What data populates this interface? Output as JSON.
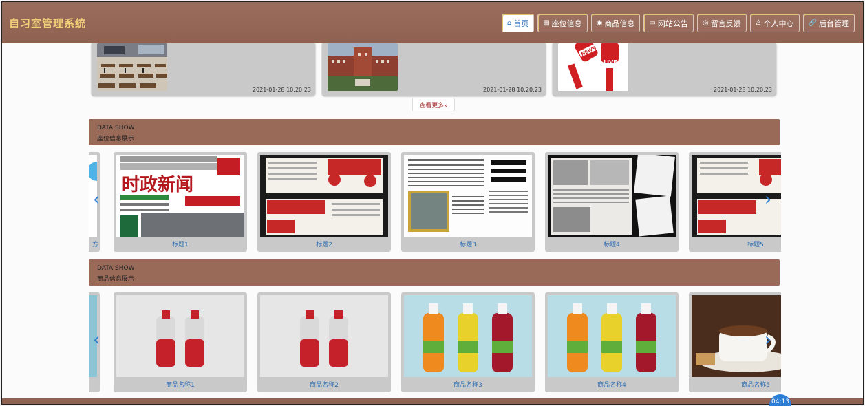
{
  "header": {
    "title": "自习室管理系统",
    "nav": [
      {
        "icon": "home-icon",
        "glyph": "⌂",
        "label": "首页"
      },
      {
        "icon": "seat-icon",
        "glyph": "▤",
        "label": "座位信息"
      },
      {
        "icon": "goods-icon",
        "glyph": "◉",
        "label": "商品信息"
      },
      {
        "icon": "notice-icon",
        "glyph": "▭",
        "label": "网站公告"
      },
      {
        "icon": "message-icon",
        "glyph": "◎",
        "label": "留言反馈"
      },
      {
        "icon": "user-icon",
        "glyph": "♙",
        "label": "个人中心"
      },
      {
        "icon": "link-icon",
        "glyph": "🔗",
        "label": "后台管理"
      }
    ]
  },
  "news": [
    {
      "time": "2021-01-28 10:20:23",
      "image": "classroom"
    },
    {
      "time": "2021-01-28 10:20:23",
      "image": "campus-building"
    },
    {
      "time": "2021-01-28 10:20:23",
      "image": "news-microphone",
      "badge1": "NEWS",
      "badge2": "LIVE"
    }
  ],
  "more_label": "查看更多»",
  "seat_section": {
    "en": "DATA SHOW",
    "cn": "座位信息展示",
    "partial_label": "方",
    "items": [
      {
        "title": "标题1",
        "image": "newspaper-cover",
        "head": "时政新闻"
      },
      {
        "title": "标题2",
        "image": "newspaper-red"
      },
      {
        "title": "标题3",
        "image": "newspaper-text"
      },
      {
        "title": "标题4",
        "image": "newspaper-gray"
      },
      {
        "title": "标题5",
        "image": "newspaper-red"
      }
    ]
  },
  "goods_section": {
    "en": "DATA SHOW",
    "cn": "商品信息展示",
    "items": [
      {
        "title": "商品名称1",
        "image": "red-bottles"
      },
      {
        "title": "商品名称2",
        "image": "red-bottles"
      },
      {
        "title": "商品名称3",
        "image": "juice-bottles"
      },
      {
        "title": "商品名称4",
        "image": "juice-bottles"
      },
      {
        "title": "商品名称5",
        "image": "coffee-cup"
      }
    ]
  },
  "timer": "04:13"
}
